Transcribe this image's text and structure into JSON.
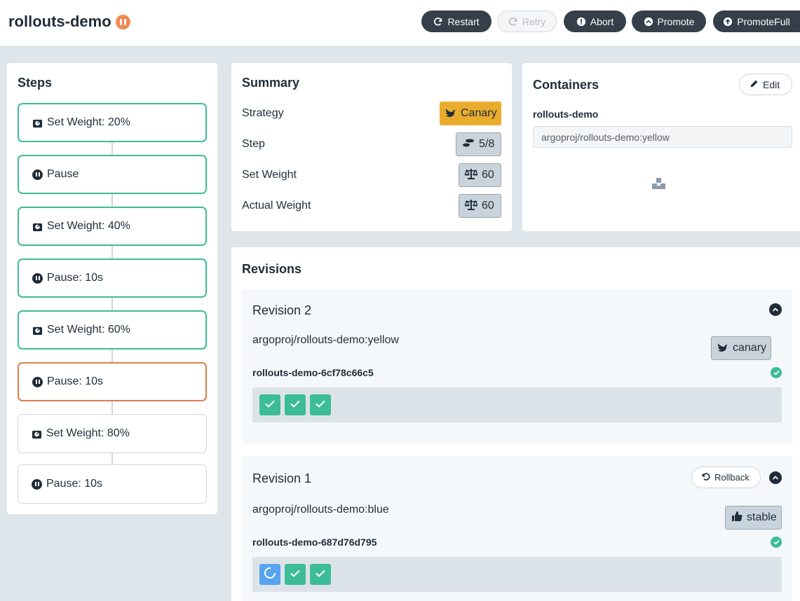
{
  "header": {
    "title": "rollouts-demo",
    "status_icon": "pause-icon",
    "status_color": "#f2884f",
    "buttons": [
      {
        "label": "Restart",
        "icon": "restart-icon",
        "enabled": true
      },
      {
        "label": "Retry",
        "icon": "retry-icon",
        "enabled": false
      },
      {
        "label": "Abort",
        "icon": "abort-icon",
        "enabled": true
      },
      {
        "label": "Promote",
        "icon": "promote-icon",
        "enabled": true
      },
      {
        "label": "PromoteFull",
        "icon": "promote-full-icon",
        "enabled": true
      }
    ]
  },
  "steps": {
    "title": "Steps",
    "items": [
      {
        "label": "Set Weight: 20%",
        "icon": "weight-icon",
        "state": "complete"
      },
      {
        "label": "Pause",
        "icon": "pause-icon",
        "state": "complete"
      },
      {
        "label": "Set Weight: 40%",
        "icon": "weight-icon",
        "state": "complete"
      },
      {
        "label": "Pause: 10s",
        "icon": "pause-icon",
        "state": "complete"
      },
      {
        "label": "Set Weight: 60%",
        "icon": "weight-icon",
        "state": "complete"
      },
      {
        "label": "Pause: 10s",
        "icon": "pause-icon",
        "state": "current"
      },
      {
        "label": "Set Weight: 80%",
        "icon": "weight-icon",
        "state": "pending"
      },
      {
        "label": "Pause: 10s",
        "icon": "pause-icon",
        "state": "pending"
      }
    ]
  },
  "summary": {
    "title": "Summary",
    "strategy_label": "Strategy",
    "strategy_value": "Canary",
    "step_label": "Step",
    "step_value": "5/8",
    "set_weight_label": "Set Weight",
    "set_weight_value": "60",
    "actual_weight_label": "Actual Weight",
    "actual_weight_value": "60"
  },
  "containers": {
    "title": "Containers",
    "edit_label": "Edit",
    "container_name": "rollouts-demo",
    "container_image": "argoproj/rollouts-demo:yellow"
  },
  "revisions": {
    "title": "Revisions",
    "items": [
      {
        "title": "Revision 2",
        "image": "argoproj/rollouts-demo:yellow",
        "badge": "canary",
        "replicaset": "rollouts-demo-6cf78c66c5",
        "pods": [
          "ready",
          "ready",
          "ready"
        ]
      },
      {
        "title": "Revision 1",
        "image": "argoproj/rollouts-demo:blue",
        "badge": "stable",
        "rollback_label": "Rollback",
        "replicaset": "rollouts-demo-687d76d795",
        "pods": [
          "progressing",
          "ready",
          "ready"
        ]
      }
    ]
  },
  "colors": {
    "success": "#3cbd97",
    "current": "#e07b4b",
    "canary": "#e9ac2c",
    "progress": "#56a3f0",
    "dark": "#343f4a"
  }
}
